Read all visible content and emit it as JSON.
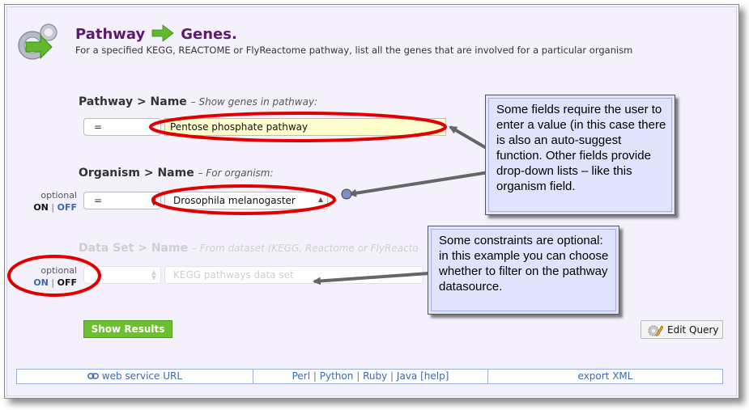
{
  "header": {
    "title_left": "Pathway",
    "title_right": "Genes.",
    "subtitle": "For a specified KEGG, REACTOME or FlyReactome pathway, list all the genes that are involved for a particular organism"
  },
  "constraints": [
    {
      "path": "Pathway > Name",
      "hint": "– Show genes in pathway:",
      "operator": "=",
      "value": "Pentose phosphate pathway"
    },
    {
      "path": "Organism > Name",
      "hint": "– For organism:",
      "operator": "=",
      "value": "Drosophila melanogaster",
      "optional_label": "optional",
      "on_label": "ON",
      "off_label": "OFF"
    },
    {
      "path": "Data Set > Name",
      "hint": "– From dataset (KEGG, Reactome or FlyReacto",
      "operator": "=",
      "value": "KEGG pathways data set",
      "optional_label": "optional",
      "on_label": "ON",
      "off_label": "OFF"
    }
  ],
  "buttons": {
    "show_results": "Show Results",
    "edit_query": "Edit Query"
  },
  "footer": {
    "web_service": "web service URL",
    "perl": "Perl",
    "python": "Python",
    "ruby": "Ruby",
    "java": "Java",
    "help": "[help]",
    "sep": "|",
    "export_xml": "export XML"
  },
  "callouts": {
    "fields": "Some fields require the user to enter a value (in this case there is also an auto-suggest function. Other fields provide drop-down lists – like this organism  field.",
    "optional": "Some constraints are optional: in this example you can choose whether to filter on the pathway datasource."
  },
  "colors": {
    "title": "#5c1c6e",
    "link": "#3a69b4",
    "highlight_ring": "#e00000",
    "show_button": "#6cbf2e",
    "callout_bg": "#dfe3fb",
    "input_bg": "#ffffcc"
  }
}
